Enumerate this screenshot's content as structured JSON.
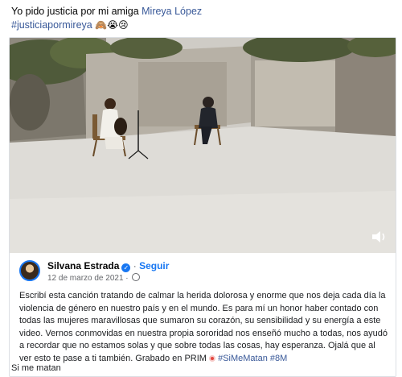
{
  "post": {
    "text_before": "Yo pido justicia por mi amiga ",
    "mention": "Mireya López",
    "hashtag": "#justiciapormireya",
    "emojis": "🙈😭😢"
  },
  "video": {
    "controls": {
      "volume_icon": "speaker-icon"
    }
  },
  "embed": {
    "author": "Silvana Estrada",
    "follow_label": "Seguir",
    "separator": "·",
    "date": "12 de marzo de 2021",
    "date_sep": " · ",
    "description_main": "Escribí esta canción tratando de calmar la herida dolorosa y enorme que nos deja cada día la violencia de género en nuestro país y en el mundo. Es para mí un honor haber contado con todas las mujeres maravillosas que sumaron su corazón, su sensibilidad y su energía a este video. Vernos conmovidas en nuestra propia sororidad nos enseñó mucho a todas, nos ayudó a recordar que no estamos solas y que sobre todas las cosas, hay esperanza. Ojalá que al ver esto te pase a ti también. Grabado en PRIM ",
    "hashtag1": "#SiMeMatan",
    "hashtag2": "#8M"
  },
  "song_title": "Si me matan",
  "colors": {
    "link": "#385898",
    "accent": "#1877f2",
    "muted": "#65676b",
    "record": "#e4463f"
  }
}
